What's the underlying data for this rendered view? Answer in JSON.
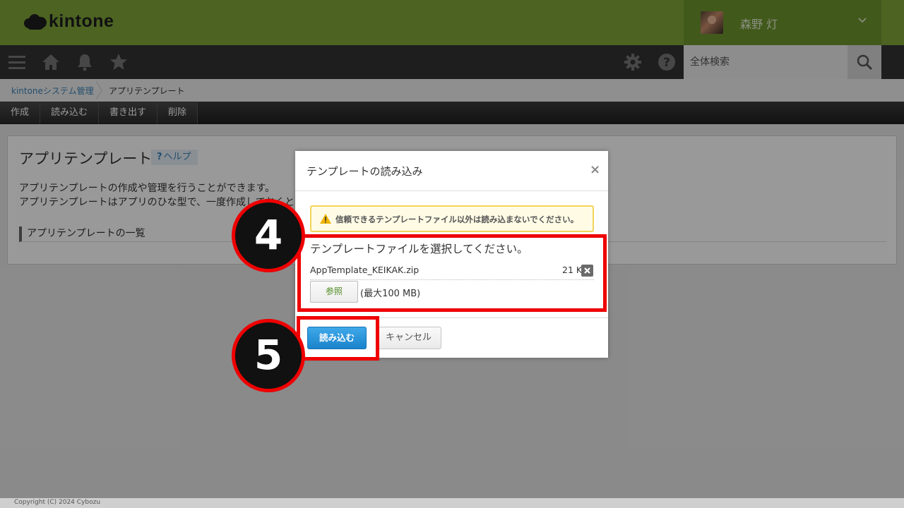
{
  "header": {
    "logo_text": "kintone",
    "user_name": "森野 灯"
  },
  "nav": {
    "search_placeholder": "全体検索"
  },
  "breadcrumb": {
    "parent": "kintoneシステム管理",
    "current": "アプリテンプレート"
  },
  "toolbar": {
    "create": "作成",
    "import": "読み込む",
    "export": "書き出す",
    "delete": "削除"
  },
  "page": {
    "title": "アプリテンプレート",
    "help": "ヘルプ",
    "desc_line1": "アプリテンプレートの作成や管理を行うことができます。",
    "desc_line2": "アプリテンプレートはアプリのひな型で、一度作成しておくと",
    "list_heading": "アプリテンプレートの一覧"
  },
  "dialog": {
    "title": "テンプレートの読み込み",
    "close": "×",
    "warning": "信頼できるテンプレートファイル以外は読み込まないでください。",
    "select_prompt": "テンプレートファイルを選択してください。",
    "file_name": "AppTemplate_KEIKAK.zip",
    "file_size": "21 KB",
    "browse": "参照",
    "max_size": "(最大100 MB)",
    "import_button": "読み込む",
    "cancel_button": "キャンセル"
  },
  "annotations": {
    "step4": "4",
    "step5": "5"
  },
  "footer": {
    "copyright": "Copyright (C) 2024 Cybozu"
  },
  "colors": {
    "header_green": "#7fa63a",
    "nav_dark": "#333333",
    "primary_blue": "#1a83cc",
    "highlight_red": "#ee0000"
  }
}
